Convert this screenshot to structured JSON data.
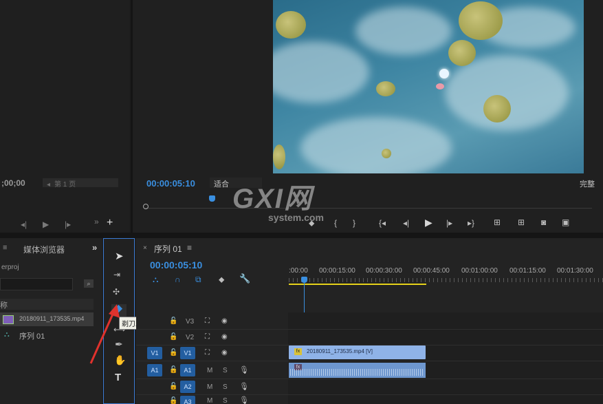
{
  "source_monitor": {
    "timecode": ";00;00",
    "page_field": "第 1 页"
  },
  "program_monitor": {
    "timecode": "00:00:05:10",
    "fit_label": "适合",
    "full_label": "完整"
  },
  "project_panel": {
    "tab_label": "媒体浏览器",
    "project_name": "erproj",
    "column_header": "称",
    "items": [
      {
        "name": "20180911_173535.mp4",
        "icon": "video-clip-icon"
      },
      {
        "name": "序列 01",
        "icon": "sequence-icon"
      }
    ]
  },
  "tools": {
    "tooltip": "剃刀工具 (C)"
  },
  "timeline": {
    "tab_label": "序列 01",
    "timecode": "00:00:05:10",
    "ruler_labels": [
      ":00:00",
      "00:00:15:00",
      "00:00:30:00",
      "00:00:45:00",
      "00:01:00:00",
      "00:01:15:00",
      "00:01:30:00"
    ],
    "tracks_video": [
      "V3",
      "V2",
      "V1"
    ],
    "tracks_audio": [
      "A1",
      "A2",
      "A3"
    ],
    "source_v": "V1",
    "source_a": "A1",
    "track_m": "M",
    "track_s": "S",
    "clip_video_label": "20180911_173535.mp4 [V]"
  },
  "watermark": {
    "brand": "GXI网",
    "domain": "system.com"
  },
  "colors": {
    "accent": "#3a8fe0",
    "clip_video": "#8fb3e8",
    "clip_audio": "#6e97cf",
    "highlight": "#3b7bd4",
    "in_out_bar": "#e6d21a"
  }
}
